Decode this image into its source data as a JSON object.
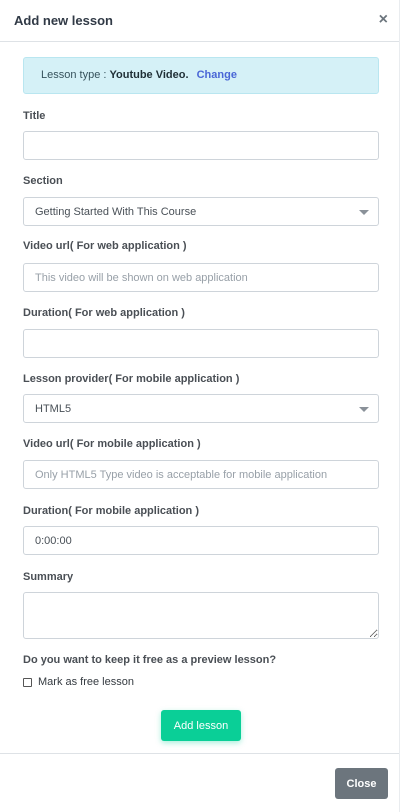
{
  "header": {
    "title": "Add new lesson",
    "close_symbol": "×"
  },
  "lesson_type": {
    "prefix": "Lesson type : ",
    "value": "Youtube Video.",
    "change_label": "Change"
  },
  "form": {
    "title": {
      "label": "Title",
      "value": "",
      "placeholder": ""
    },
    "section": {
      "label": "Section",
      "selected": "Getting Started With This Course"
    },
    "web_video_url": {
      "label": "Video url( For web application )",
      "value": "",
      "placeholder": "This video will be shown on web application"
    },
    "web_duration": {
      "label": "Duration( For web application )",
      "value": "",
      "placeholder": ""
    },
    "mobile_provider": {
      "label": "Lesson provider( For mobile application )",
      "selected": "HTML5"
    },
    "mobile_video_url": {
      "label": "Video url( For mobile application )",
      "value": "",
      "placeholder": "Only HTML5 Type video is acceptable for mobile application"
    },
    "mobile_duration": {
      "label": "Duration( For mobile application )",
      "value": "0:00:00"
    },
    "summary": {
      "label": "Summary",
      "value": ""
    },
    "free_preview": {
      "question": "Do you want to keep it free as a preview lesson?",
      "checkbox_label": "Mark as free lesson",
      "checked": false
    }
  },
  "actions": {
    "submit_label": "Add lesson"
  },
  "footer": {
    "close_label": "Close"
  },
  "colors": {
    "primary": "#0acf97",
    "secondary": "#6c757d",
    "alert_bg": "#d5f1f7",
    "link": "#4a67d6"
  }
}
